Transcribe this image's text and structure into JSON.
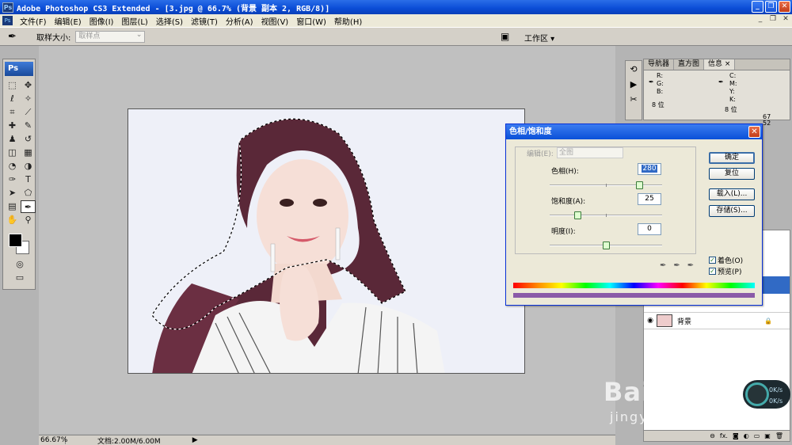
{
  "window": {
    "app_icon": "Ps",
    "title": "Adobe Photoshop CS3 Extended - [3.jpg @ 66.7% (背景 副本 2, RGB/8)]",
    "buttons": [
      "_",
      "❐",
      "✕"
    ]
  },
  "menu": {
    "icon": "Ps",
    "items": [
      "文件(F)",
      "编辑(E)",
      "图像(I)",
      "图层(L)",
      "选择(S)",
      "滤镜(T)",
      "分析(A)",
      "视图(V)",
      "窗口(W)",
      "帮助(H)"
    ],
    "doc_buttons": [
      "_",
      "❐",
      "✕"
    ]
  },
  "options": {
    "sample_size_label": "取样大小:",
    "sample_size_value": "取样点",
    "workspace_label": "工作区 ▾"
  },
  "toolbox": {
    "logo": "Ps"
  },
  "status": {
    "zoom": "66.67%",
    "doc_size": "文档:2.00M/6.00M",
    "arrow": "▶"
  },
  "info_panel": {
    "tabs": [
      "导航器",
      "直方图",
      "信息 ×"
    ],
    "r": "R:",
    "g": "G:",
    "b": "B:",
    "c": "C:",
    "m": "M:",
    "y": "Y:",
    "k": "K:",
    "bits_left": "8 位",
    "bits_right": "8 位",
    "partial_1": "67",
    "partial_2": "52"
  },
  "layers": {
    "background_name": "背景",
    "bottom_icons": [
      "⊖",
      "fx.",
      "◙",
      "◐",
      "▭",
      "▣",
      "🗑"
    ]
  },
  "dialog": {
    "title": "色相/饱和度",
    "edit_label": "编辑(E):",
    "edit_value": "全图",
    "hue_label": "色相(H):",
    "hue_value": "280",
    "saturation_label": "饱和度(A):",
    "saturation_value": "25",
    "lightness_label": "明度(I):",
    "lightness_value": "0",
    "ok": "确定",
    "reset": "复位",
    "load": "载入(L)...",
    "save": "存储(S)...",
    "colorize": "着色(O)",
    "preview": "预览(P)",
    "colorize_checked": true,
    "preview_checked": true,
    "hue_level": 0.8,
    "saturation_level": 0.25,
    "lightness_level": 0.5
  },
  "watermark": {
    "brand": "Bai 经验",
    "url": "jingyan.baidu.com"
  },
  "network": {
    "down": "0K/s",
    "up": "0K/s"
  }
}
